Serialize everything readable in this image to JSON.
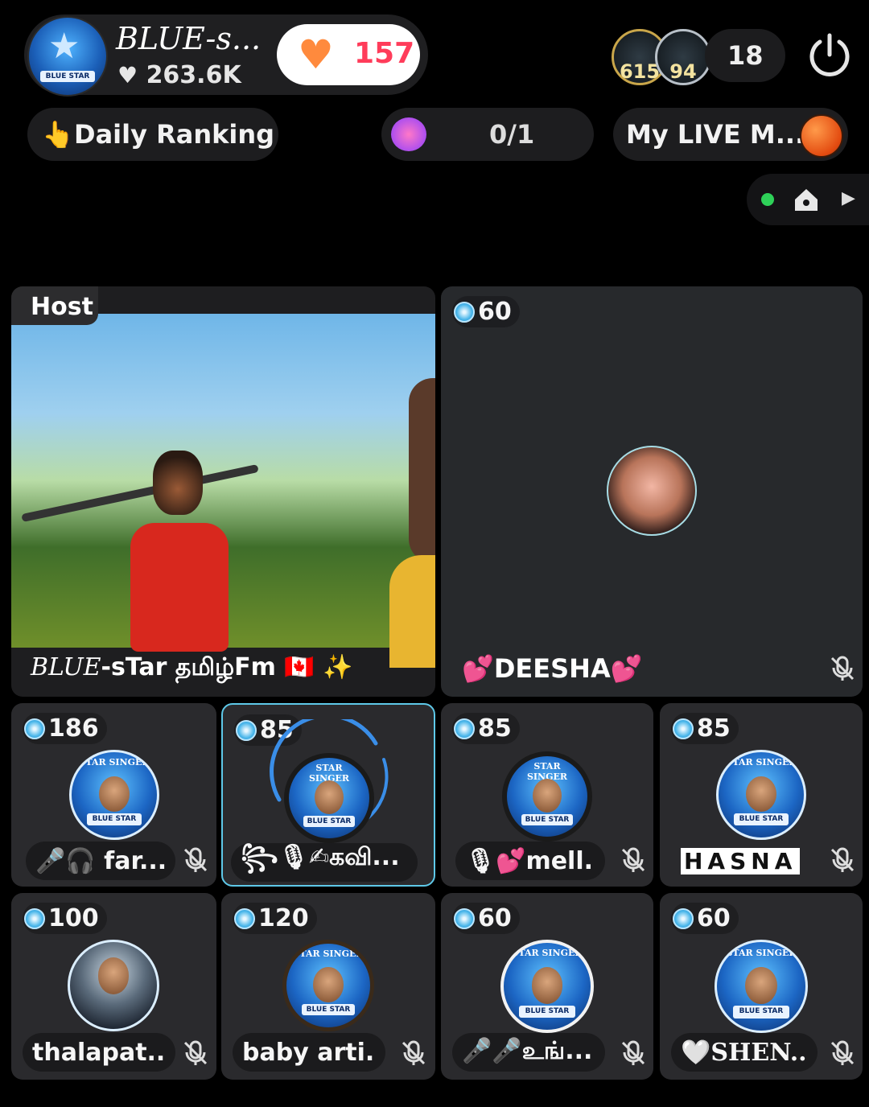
{
  "header": {
    "host_name": "BLUE-s...",
    "host_followers": "263.6K",
    "follow_count": "157",
    "viewer_badges": [
      "615",
      "94"
    ],
    "viewer_count": "18"
  },
  "toolbar": {
    "ranking_label": "Daily Ranking",
    "task_progress": "0/1",
    "mylive_label": "My LIVE M..."
  },
  "host": {
    "tag": "Host",
    "title_prefix": "BLUE",
    "title_rest": "-sTar தமிழ்Fm 🇨🇦 ✨"
  },
  "seats": [
    {
      "level": "60",
      "name": "💕DEESHA💕"
    },
    {
      "level": "186",
      "name": "🎤🎧 far..."
    },
    {
      "level": "85",
      "name": "꧂🎙✍கவி..."
    },
    {
      "level": "85",
      "name": "🎙💕mell..."
    },
    {
      "level": "85",
      "name": "HASNA"
    },
    {
      "level": "100",
      "name": "thalapat..."
    },
    {
      "level": "120",
      "name": "baby arti..."
    },
    {
      "level": "60",
      "name": "🎤🎤உங்..."
    },
    {
      "level": "60",
      "name": "🤍SHEN..."
    }
  ],
  "colors": {
    "accent_red": "#ff3c5a",
    "level_blue": "#49b6ea",
    "active_border": "#5ec8e8",
    "online_green": "#2ed158"
  }
}
